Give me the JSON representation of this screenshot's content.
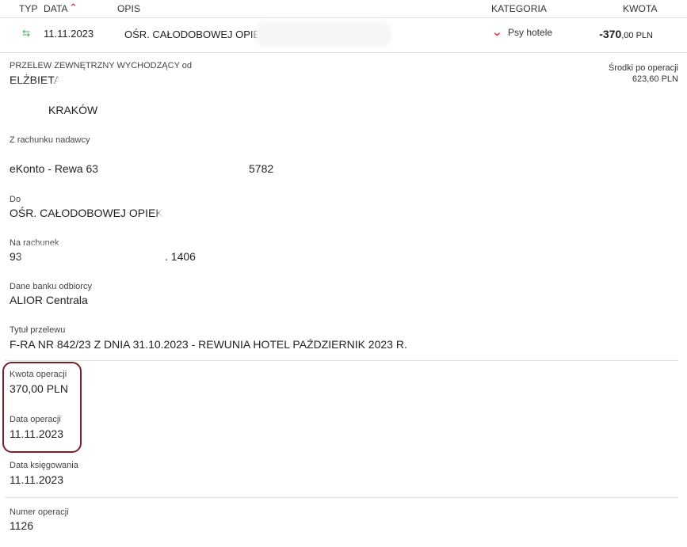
{
  "table_header": {
    "typ": "TYP",
    "data": "DATA",
    "opis": "OPIS",
    "kategoria": "KATEGORIA",
    "kwota": "KWOTA",
    "sort_icon": "chevron-up-icon"
  },
  "transaction": {
    "type_icon": "transfer-arrows-icon",
    "date": "11.11.2023",
    "description": "OŚR. CAŁODOBOWEJ OPIEKI",
    "category": "Psy hotele",
    "amount_int": "-370",
    "amount_frac": ",00 PLN"
  },
  "details": {
    "transfer_type": "PRZELEW ZEWNĘTRZNY WYCHODZĄCY od",
    "sender_name": "ELŻBIETA",
    "sender_city": "KRAKÓW",
    "balance_label": "Środki po operacji",
    "balance_value": "623,60 PLN",
    "from_account_label": "Z rachunku nadawcy",
    "from_account_name": "eKonto - Rewa 63",
    "from_account_suffix": "5782",
    "to_label": "Do",
    "to_value": "OŚR. CAŁODOBOWEJ OPIEKI",
    "to_account_label": "Na rachunek",
    "to_account_prefix": "93",
    "to_account_suffix": ". 1406",
    "bank_label": "Dane banku odbiorcy",
    "bank_value": "ALIOR Centrala",
    "title_label": "Tytuł przelewu",
    "title_value": "F-RA NR 842/23 Z DNIA 31.10.2023 - REWUNIA HOTEL PAŹDZIERNIK 2023 R.",
    "amount_label": "Kwota operacji",
    "amount_value": "370,00 PLN",
    "op_date_label": "Data operacji",
    "op_date_value": "11.11.2023",
    "booking_date_label": "Data księgowania",
    "booking_date_value": "11.11.2023",
    "op_number_label": "Numer operacji",
    "op_number_value": "1126"
  },
  "colors": {
    "accent_red": "#d9232d",
    "highlight_border": "#7a1f2b",
    "transfer_icon": "#4caf50"
  }
}
